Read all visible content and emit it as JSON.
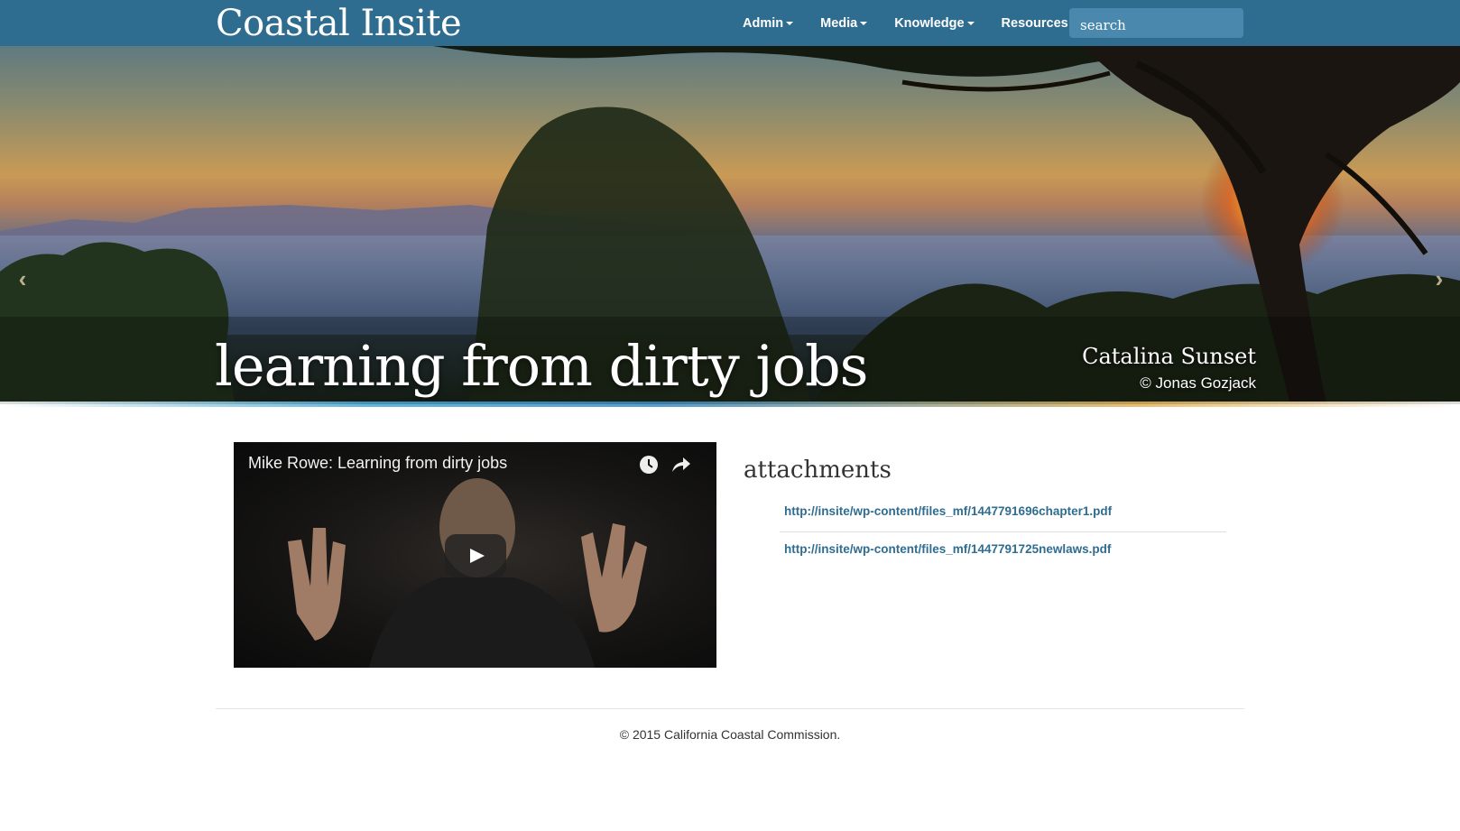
{
  "brand": {
    "name": "Coastal Insite"
  },
  "nav": {
    "items": [
      {
        "label": "Admin"
      },
      {
        "label": "Media"
      },
      {
        "label": "Knowledge"
      },
      {
        "label": "Resources"
      }
    ],
    "search_placeholder": "search"
  },
  "hero": {
    "title": "learning from dirty jobs",
    "photo_title": "Catalina Sunset",
    "photo_credit": "© Jonas Gozjack",
    "prev_icon": "chevron-left-icon",
    "next_icon": "chevron-right-icon"
  },
  "video": {
    "title": "Mike Rowe: Learning from dirty jobs",
    "icons": [
      "watch-later-icon",
      "share-icon",
      "play-icon"
    ]
  },
  "attachments": {
    "heading": "attachments",
    "links": [
      "http://insite/wp-content/files_mf/1447791696chapter1.pdf",
      "http://insite/wp-content/files_mf/1447791725newlaws.pdf"
    ]
  },
  "footer": {
    "text": "© 2015 California Coastal Commission."
  },
  "colors": {
    "navbar": "#2f6d90",
    "link": "#2f6d90",
    "search_bg": "#4a88ad"
  }
}
